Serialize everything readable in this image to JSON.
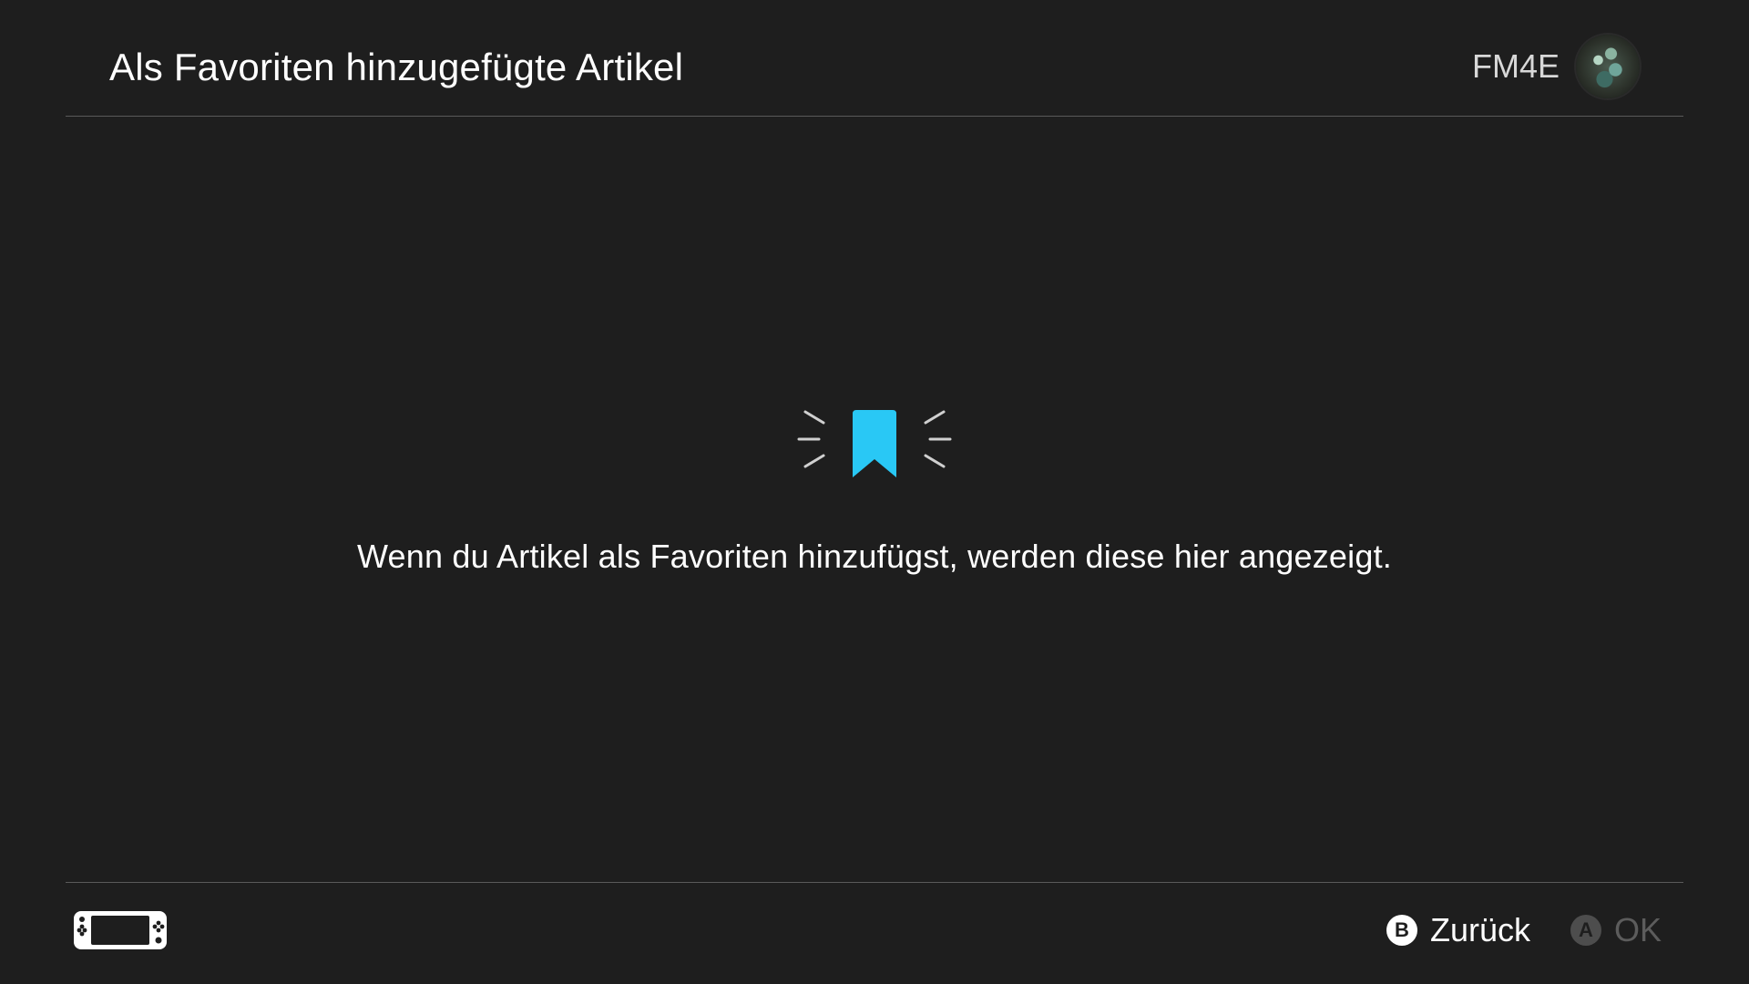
{
  "header": {
    "title": "Als Favoriten hinzugefügte Artikel",
    "user_name": "FM4E"
  },
  "empty_state": {
    "message": "Wenn du Artikel als Favoriten hinzufügst, werden diese hier angezeigt.",
    "icon": "bookmark-icon",
    "icon_color": "#29c8f5"
  },
  "footer": {
    "device_icon": "handheld-console-icon",
    "controls": [
      {
        "button": "B",
        "label": "Zurück",
        "enabled": true
      },
      {
        "button": "A",
        "label": "OK",
        "enabled": false
      }
    ]
  },
  "colors": {
    "background": "#1e1e1e",
    "divider": "#5a5a5a",
    "accent": "#29c8f5",
    "disabled": "#5c5c5c"
  }
}
